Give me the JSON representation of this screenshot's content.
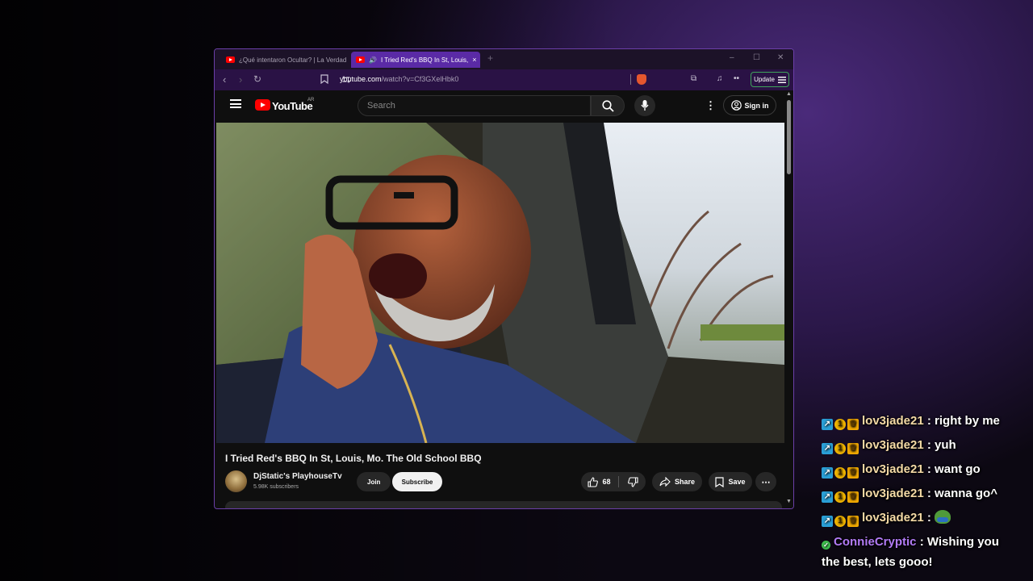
{
  "browser": {
    "tabs": [
      {
        "title": "¿Qué intentaron Ocultar? | La Verdad",
        "active": false
      },
      {
        "title": "I Tried Red's BBQ In St, Louis,",
        "active": true
      }
    ],
    "tab_close": "×",
    "new_tab": "+",
    "window_controls": {
      "minimize": "–",
      "maximize": "☐",
      "close": "✕"
    },
    "url_host": "youtube.com",
    "url_path": "/watch?v=Cf3GXelHbk0",
    "update_label": "Update",
    "accent": "#6b3fa8"
  },
  "youtube": {
    "logo_text": "YouTube",
    "region": "AR",
    "search_placeholder": "Search",
    "signin_label": "Sign in",
    "video_title": "I Tried Red's BBQ In St, Louis, Mo. The Old School BBQ",
    "channel_name": "DjStatic's  PlayhouseTv",
    "subscribers": "5.98K subscribers",
    "join_label": "Join",
    "subscribe_label": "Subscribe",
    "likes": "68",
    "share_label": "Share",
    "save_label": "Save"
  },
  "chat": {
    "messages": [
      {
        "user": "lov3jade21",
        "text": ": right by me",
        "badges": [
          "prime",
          "one",
          "crown"
        ]
      },
      {
        "user": "lov3jade21",
        "text": ": yuh",
        "badges": [
          "prime",
          "one",
          "crown"
        ]
      },
      {
        "user": "lov3jade21",
        "text": ": want go",
        "badges": [
          "prime",
          "one",
          "crown"
        ]
      },
      {
        "user": "lov3jade21",
        "text": ": wanna go^",
        "badges": [
          "prime",
          "one",
          "crown"
        ]
      },
      {
        "user": "lov3jade21",
        "text": ":",
        "badges": [
          "prime",
          "one",
          "crown"
        ],
        "emote": "pepe-emote"
      },
      {
        "user": "ConnieCryptic",
        "text": ": Wishing you",
        "badges": [
          "verified"
        ]
      },
      {
        "user": "",
        "text": "the best, lets gooo!",
        "badges": []
      }
    ]
  }
}
